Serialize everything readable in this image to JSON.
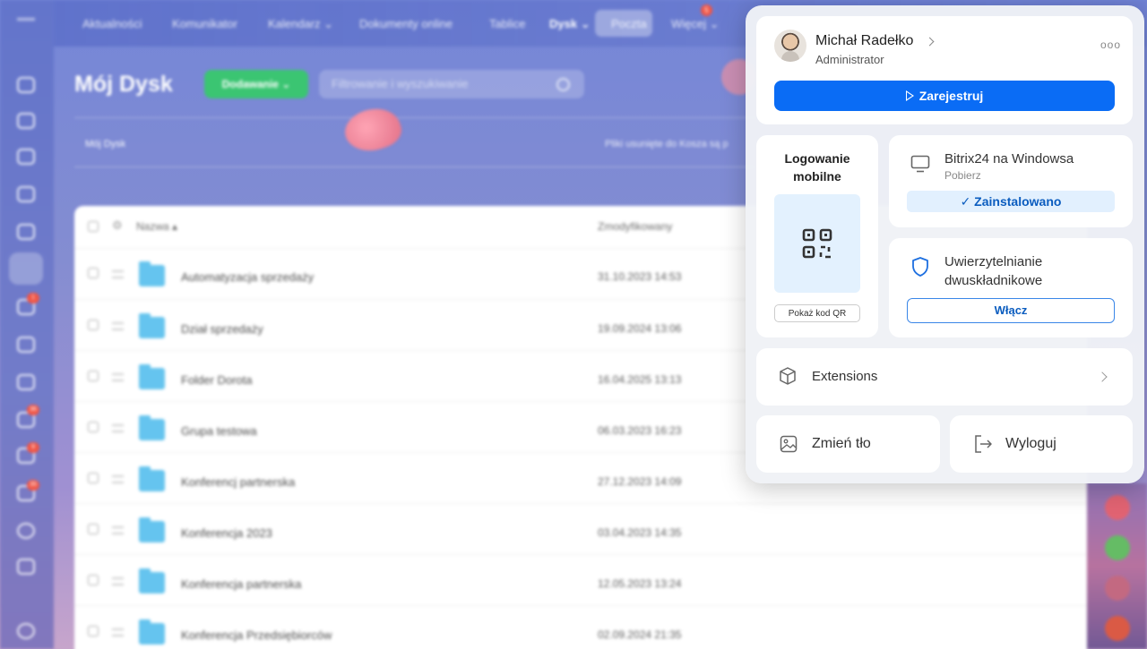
{
  "topnav": {
    "items": [
      "Aktualności",
      "Komunikator",
      "Kalendarz ⌄",
      "Dokumenty online",
      "Tablice",
      "Dysk ⌄",
      "Poczta",
      "Więcej ⌄"
    ],
    "mail_badge": "5"
  },
  "left_rail": {
    "badges": [
      "1",
      "36",
      "9",
      "35"
    ]
  },
  "page": {
    "title": "Mój Dysk",
    "add_button": "Dodawanie ⌄",
    "filter_placeholder": "Filtrowanie i wyszukiwanie",
    "breadcrumb": "Mój Dysk",
    "trash_note": "Pliki usunięte do Kosza są p"
  },
  "table": {
    "columns": [
      "Nazwa ▴",
      "Zmodyfikowany"
    ],
    "rows": [
      {
        "name": "Automatyzacja sprzedaży",
        "date": "31.10.2023 14:53"
      },
      {
        "name": "Dział sprzedaży",
        "date": "19.09.2024 13:06"
      },
      {
        "name": "Folder Dorota",
        "date": "16.04.2025 13:13"
      },
      {
        "name": "Grupa testowa",
        "date": "06.03.2023 16:23"
      },
      {
        "name": "Konferencj partnerska",
        "date": "27.12.2023 14:09"
      },
      {
        "name": "Konferencja 2023",
        "date": "03.04.2023 14:35"
      },
      {
        "name": "Konferencja partnerska",
        "date": "12.05.2023 13:24"
      },
      {
        "name": "Konferencja Przedsiębiorców",
        "date": "02.09.2024 21:35"
      }
    ]
  },
  "popup": {
    "user": {
      "name": "Michał Radełko",
      "role": "Administrator",
      "more": "ooo"
    },
    "register_button": "Zarejestruj",
    "mobile_login": {
      "title": "Logowanie mobilne",
      "qr_button": "Pokaż kod QR"
    },
    "desktop_app": {
      "title": "Bitrix24 na Windowsa",
      "subtitle": "Pobierz",
      "status": "✓ Zainstalowano"
    },
    "two_factor": {
      "title": "Uwierzytelnianie dwuskładnikowe",
      "button": "Włącz"
    },
    "extensions": {
      "label": "Extensions"
    },
    "change_background": {
      "label": "Zmień tło"
    },
    "logout": {
      "label": "Wyloguj"
    }
  },
  "colors": {
    "primary": "#0a6cf5",
    "add_green": "#2fc26a",
    "badge_red": "#f04b3a"
  }
}
